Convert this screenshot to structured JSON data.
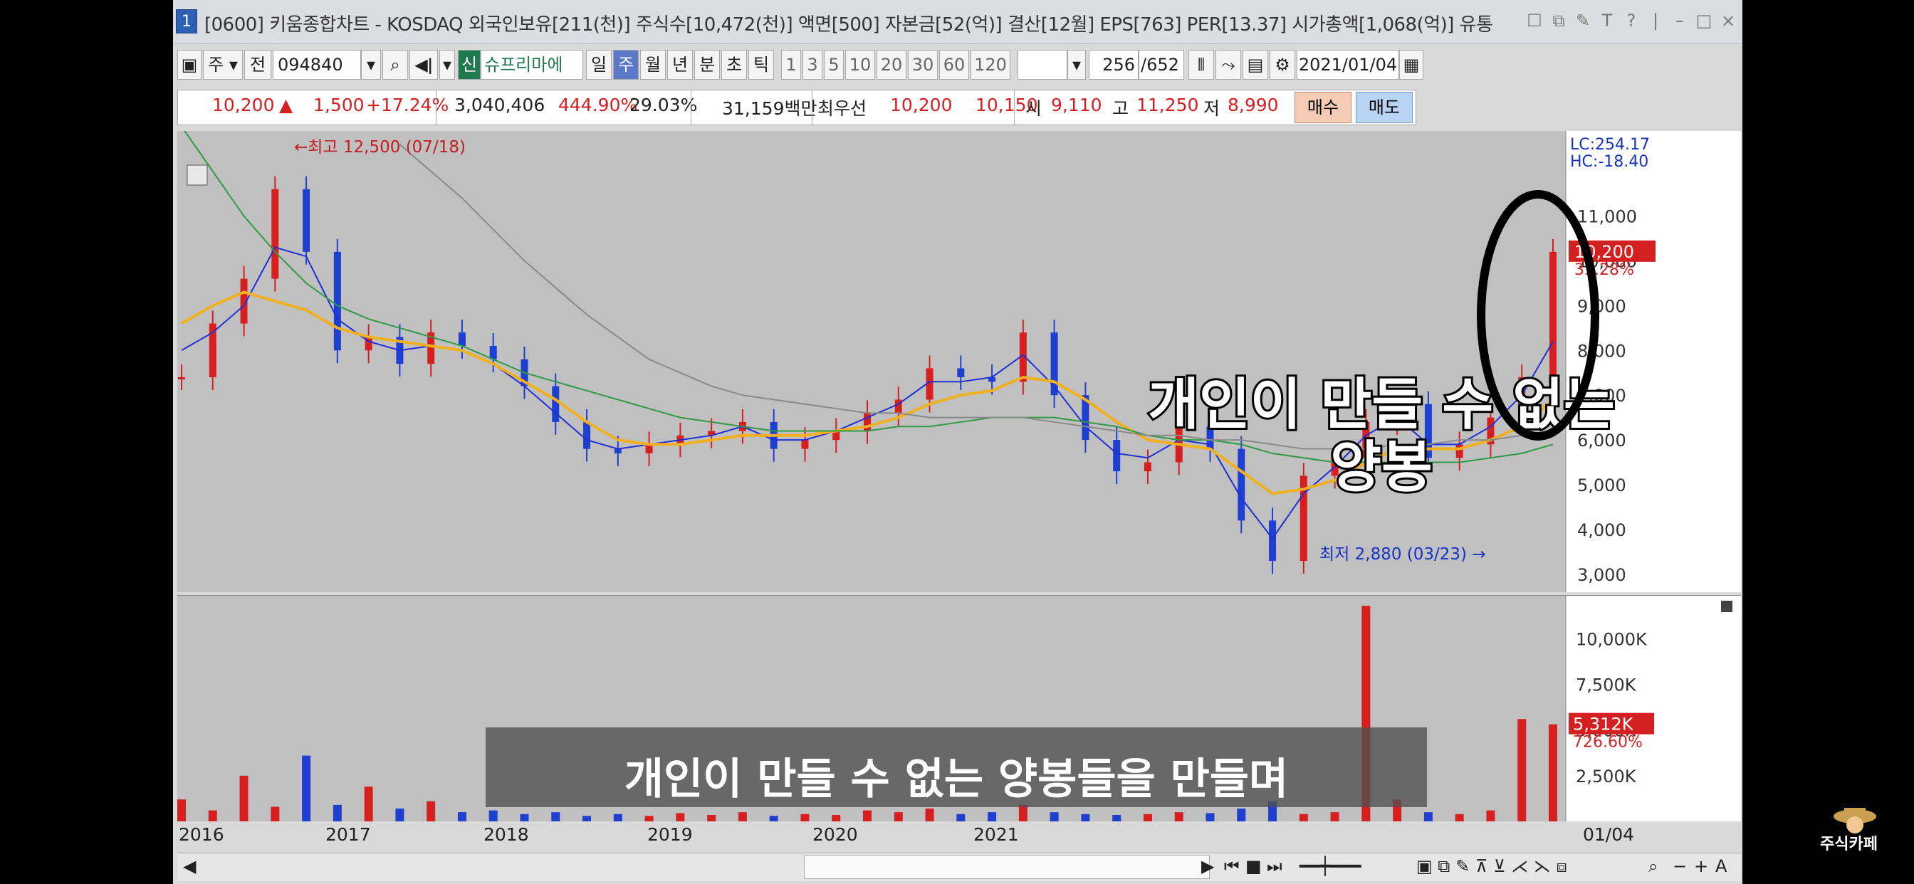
{
  "title_bar": {
    "icon_label": "1",
    "text": "[0600] 키움종합차트 - KOSDAQ 외국인보유[211(천)] 주식수[10,472(천)] 액면[500] 자본금[52(억)] 결산[12월] EPS[763] PER[13.37] 시가총액[1,068(억)] 유통"
  },
  "toolbar1": {
    "market": "주",
    "prefix": "전",
    "code": "094840",
    "signal_label": "신",
    "stock_name": "슈프리마에",
    "period_tabs": [
      "일",
      "주",
      "월",
      "년",
      "분",
      "초",
      "틱"
    ],
    "active_period": "주",
    "intervals": [
      "1",
      "3",
      "5",
      "10",
      "20",
      "30",
      "60",
      "120"
    ],
    "count": "256",
    "total": "/652",
    "date": "2021/01/04"
  },
  "quote": {
    "price": "10,200",
    "change": "1,500",
    "change_pct": "+17.24%",
    "volume": "3,040,406",
    "vol_pct": "444.90%",
    "turnover": "29.03%",
    "amount": "31,159백만",
    "label_best": "최우선",
    "ask": "10,200",
    "bid": "10,150",
    "open_label": "시",
    "open": "9,110",
    "high_label": "고",
    "high": "11,250",
    "low_label": "저",
    "low": "8,990",
    "buy": "매수",
    "sell": "매도"
  },
  "chart_data": {
    "type": "line",
    "title": "",
    "high_marker": "최고 12,500 (07/18)",
    "low_marker": "최저 2,880 (03/23)",
    "lc": "LC:254.17",
    "hc": "HC:-18.40",
    "current_price_label": "10,200",
    "current_pct_label": "35.28%",
    "price_ticks": [
      "11,000",
      "10,000",
      "9,000",
      "8,000",
      "7,000",
      "6,000",
      "5,000",
      "4,000",
      "3,000"
    ],
    "price_tick_values": [
      11000,
      10000,
      9000,
      8000,
      7000,
      6000,
      5000,
      4000,
      3000
    ],
    "ylim": [
      2600,
      12900
    ],
    "x": [
      "2016",
      "2017",
      "2018",
      "2019",
      "2020",
      "2021"
    ],
    "x_end_label": "01/04",
    "close_series": [
      7400,
      8600,
      9600,
      11600,
      10200,
      8000,
      8300,
      7700,
      8400,
      8100,
      7800,
      7200,
      6400,
      5800,
      5700,
      5900,
      6100,
      6200,
      6400,
      5800,
      6000,
      6200,
      6600,
      6900,
      7600,
      7400,
      7300,
      8400,
      7000,
      6000,
      5300,
      5500,
      6300,
      5800,
      4200,
      3300,
      5200,
      5600,
      6400,
      6800,
      5600,
      5900,
      6500,
      7400,
      10200
    ],
    "ma_series": [
      {
        "color": "#1f2fd6",
        "values": [
          8000,
          8400,
          9000,
          10300,
          10100,
          8700,
          8200,
          8000,
          8100,
          8000,
          7700,
          7200,
          6600,
          6000,
          5800,
          5900,
          6000,
          6100,
          6300,
          6000,
          6000,
          6200,
          6500,
          6800,
          7300,
          7300,
          7400,
          7900,
          7200,
          6300,
          5700,
          5600,
          6000,
          5900,
          4700,
          3800,
          4800,
          5400,
          6100,
          6500,
          5900,
          5900,
          6300,
          7000,
          8200
        ]
      },
      {
        "color": "#f0b020",
        "values": [
          8600,
          9000,
          9300,
          9100,
          8900,
          8500,
          8300,
          8200,
          8100,
          8000,
          7700,
          7300,
          6900,
          6400,
          6000,
          5900,
          5900,
          6000,
          6100,
          6100,
          6100,
          6200,
          6300,
          6500,
          6800,
          7000,
          7100,
          7400,
          7300,
          6900,
          6400,
          6000,
          5900,
          5800,
          5300,
          4800,
          4900,
          5100,
          5500,
          5800,
          5800,
          5800,
          6000,
          6300,
          6900
        ]
      },
      {
        "color": "#2f9a44",
        "values": [
          13000,
          12000,
          11000,
          10200,
          9500,
          9000,
          8700,
          8500,
          8300,
          8100,
          7800,
          7500,
          7300,
          7100,
          6900,
          6700,
          6500,
          6400,
          6300,
          6200,
          6200,
          6200,
          6200,
          6300,
          6300,
          6400,
          6500,
          6500,
          6500,
          6400,
          6300,
          6100,
          6000,
          6000,
          5900,
          5700,
          5600,
          5500,
          5500,
          5500,
          5500,
          5500,
          5600,
          5700,
          5900
        ]
      },
      {
        "color": "#8a8a8a",
        "values": [
          null,
          null,
          null,
          null,
          null,
          null,
          null,
          12600,
          12000,
          11400,
          10700,
          10000,
          9400,
          8800,
          8300,
          7800,
          7500,
          7200,
          7000,
          6900,
          6800,
          6700,
          6600,
          6600,
          6500,
          6500,
          6500,
          6500,
          6400,
          6300,
          6200,
          6100,
          6100,
          6000,
          6000,
          5900,
          5800,
          5800,
          5800,
          5900,
          5900,
          6000,
          6000,
          6100,
          6200
        ]
      }
    ],
    "volume_ticks": [
      "10,000K",
      "7,500K",
      "5,000K",
      "2,500K"
    ],
    "volume_tick_values": [
      10000,
      7500,
      5000,
      2500
    ],
    "volume_ylim": [
      0,
      12000
    ],
    "current_volume_label": "5,312K",
    "current_volume_pct": "726.60%",
    "volume_values": [
      1200,
      600,
      2500,
      800,
      3600,
      900,
      1900,
      700,
      1100,
      500,
      600,
      400,
      500,
      300,
      400,
      300,
      450,
      350,
      500,
      300,
      400,
      350,
      600,
      500,
      700,
      400,
      500,
      900,
      500,
      400,
      350,
      400,
      500,
      450,
      700,
      1100,
      400,
      500,
      11800,
      1200,
      500,
      400,
      600,
      5600,
      5312
    ]
  },
  "overlay": {
    "annotation_line1": "개인이 만들 수 없는",
    "annotation_line2": "양봉",
    "caption": "개인이 만들 수 없는 양봉들을 만들며",
    "logo_text": "주식카페"
  }
}
